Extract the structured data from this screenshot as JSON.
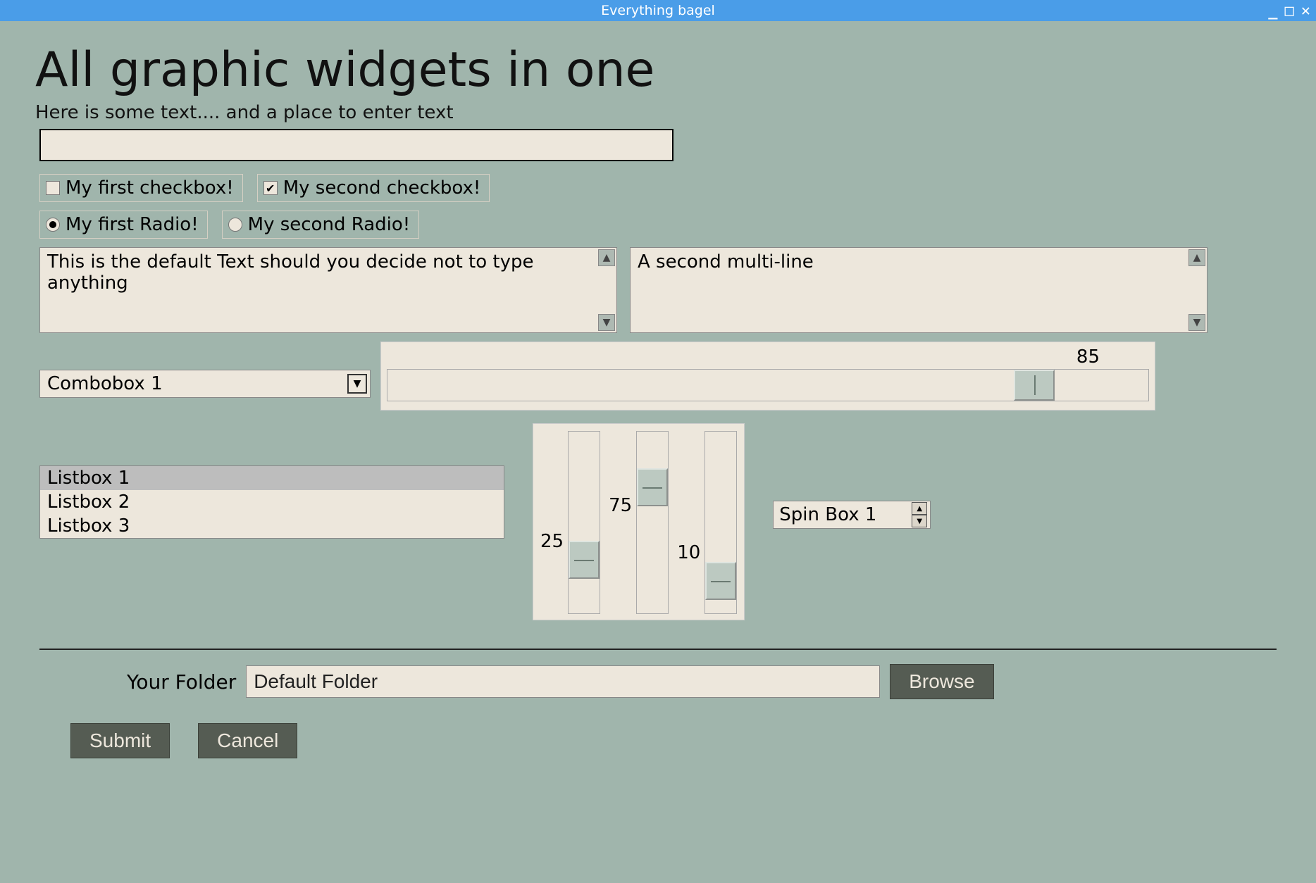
{
  "window": {
    "title": "Everything bagel"
  },
  "heading": "All graphic widgets in one",
  "subtext": "Here is some text.... and a place to enter text",
  "text_input": {
    "value": ""
  },
  "checkboxes": {
    "first": {
      "label": "My first checkbox!",
      "checked": false
    },
    "second": {
      "label": "My second checkbox!",
      "checked": true
    }
  },
  "radios": {
    "first": {
      "label": "My first Radio!",
      "selected": true
    },
    "second": {
      "label": "My second Radio!",
      "selected": false
    }
  },
  "multiline1": "This is the default Text should you decide not to type anything",
  "multiline2": "A second multi-line",
  "combo": {
    "selected": "Combobox 1"
  },
  "hslider": {
    "value": 85
  },
  "listbox": {
    "items": [
      "Listbox 1",
      "Listbox 2",
      "Listbox 3"
    ],
    "selected_index": 0
  },
  "vsliders": [
    {
      "value": 25
    },
    {
      "value": 75
    },
    {
      "value": 10
    }
  ],
  "spin": {
    "value": "Spin Box 1"
  },
  "folder": {
    "label": "Your Folder",
    "value": "Default Folder"
  },
  "buttons": {
    "browse": "Browse",
    "submit": "Submit",
    "cancel": "Cancel"
  }
}
